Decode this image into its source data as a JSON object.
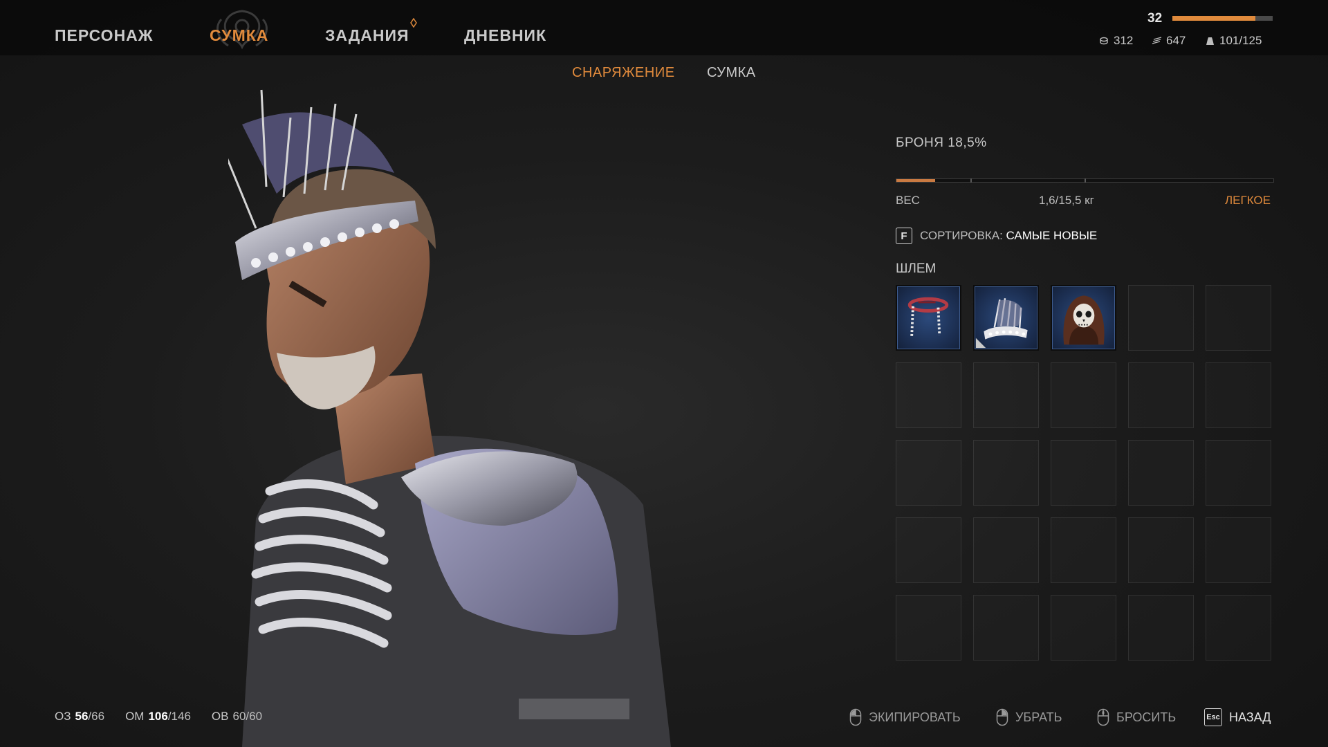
{
  "nav": {
    "tabs": [
      {
        "label": "ПЕРСОНАЖ",
        "active": false
      },
      {
        "label": "СУМКА",
        "active": true
      },
      {
        "label": "ЗАДАНИЯ",
        "active": false
      },
      {
        "label": "ДНЕВНИК",
        "active": false
      }
    ]
  },
  "player": {
    "level": "32",
    "xp_progress": 0.83,
    "currency1": "312",
    "currency2": "647",
    "capacity": "101/125"
  },
  "subtabs": [
    {
      "label": "СНАРЯЖЕНИЕ",
      "active": true
    },
    {
      "label": "СУМКА",
      "active": false
    }
  ],
  "panel": {
    "armor_label": "БРОНЯ 18,5%",
    "weight_label": "ВЕС",
    "weight_value": "1,6/15,5 кг",
    "weight_fraction": 0.103,
    "weight_class": "ЛЕГКОЕ",
    "sort_key": "F",
    "sort_label": "СОРТИРОВКА:",
    "sort_value": "САМЫЕ НОВЫЕ",
    "category": "ШЛЕМ",
    "items": [
      {
        "icon": "red-circlet-icon"
      },
      {
        "icon": "silver-crown-icon"
      },
      {
        "icon": "skull-hood-icon"
      }
    ],
    "total_slots": 25
  },
  "stats": {
    "hp_label": "ОЗ",
    "hp_cur": "56",
    "hp_max": "/66",
    "mp_label": "ОМ",
    "mp_cur": "106",
    "mp_max": "/146",
    "ov_label": "ОВ",
    "ov_value": "60/60"
  },
  "hints": {
    "equip": "ЭКИПИРОВАТЬ",
    "remove": "УБРАТЬ",
    "drop": "БРОСИТЬ",
    "back_key": "Esc",
    "back": "НАЗАД"
  },
  "colors": {
    "accent": "#e08a3c",
    "slot_filled": "#1b2d4f"
  }
}
